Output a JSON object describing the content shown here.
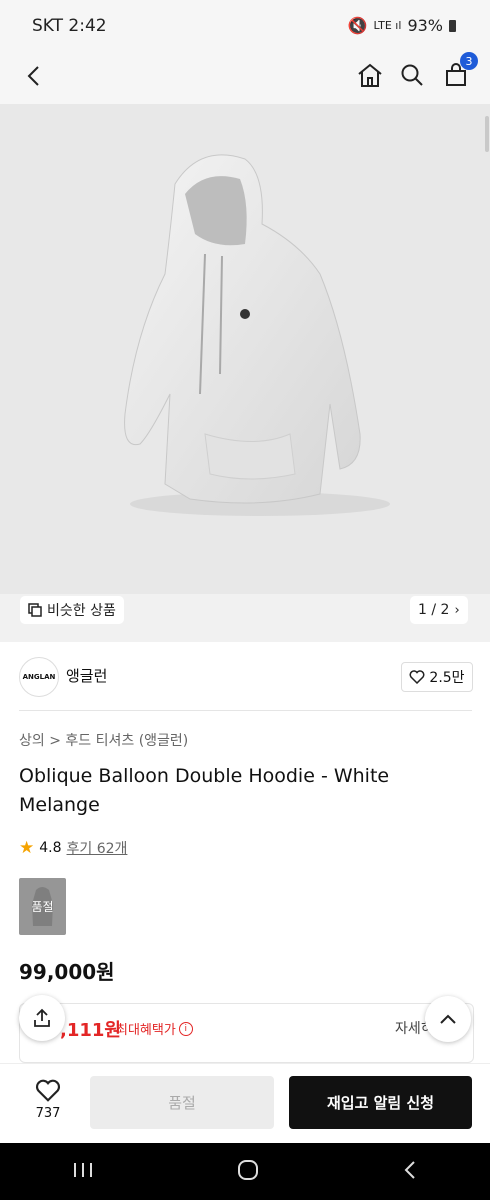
{
  "status": {
    "time": "SKT 2:42",
    "battery": "93%"
  },
  "header": {
    "cart_count": "3"
  },
  "image": {
    "similar_label": "비슷한 상품",
    "pager": "1 / 2"
  },
  "brand": {
    "logo_text": "ANGLAN",
    "name": "앵글런",
    "likes": "2.5만"
  },
  "product": {
    "breadcrumb": "상의  >  후드 티셔츠 (앵글런)",
    "title": "Oblique Balloon Double Hoodie - White Melange",
    "rating": "4.8",
    "reviews": "후기 62개",
    "thumb_label": "품절",
    "price": "99,000원"
  },
  "benefit": {
    "price": ",111원",
    "label": "최대혜택가",
    "more": "자세히"
  },
  "bottom": {
    "like_count": "737",
    "soldout_label": "품절",
    "restock_label": "재입고 알림 신청"
  },
  "colors": {
    "accent_red": "#e32626",
    "badge_blue": "#1e5bd8",
    "cta_black": "#111111"
  }
}
